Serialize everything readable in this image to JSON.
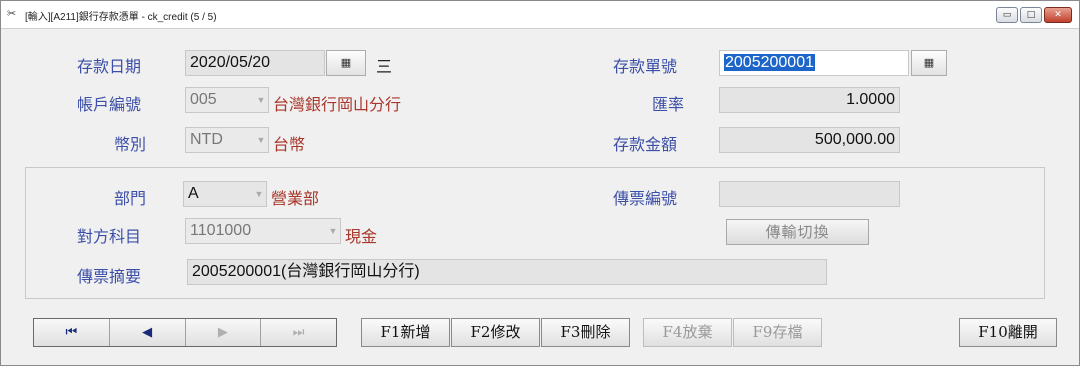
{
  "window": {
    "title": "[輸入][A211]銀行存款憑單 - ck_credit   (5 / 5)",
    "controls": [
      "minimize-icon",
      "maximize-icon",
      "close-icon"
    ]
  },
  "form": {
    "deposit_date": {
      "label": "存款日期",
      "value": "2020/05/20",
      "weekday": "三"
    },
    "account_no": {
      "label": "帳戶編號",
      "value": "005",
      "desc": "台灣銀行岡山分行"
    },
    "currency": {
      "label": "幣別",
      "value": "NTD",
      "desc": "台幣"
    },
    "deposit_no": {
      "label": "存款單號",
      "value": "2005200001"
    },
    "exchange_rate": {
      "label": "匯率",
      "value": "1.0000"
    },
    "deposit_amount": {
      "label": "存款金額",
      "value": "500,000.00"
    },
    "department": {
      "label": "部門",
      "value": "A",
      "desc": "營業部"
    },
    "voucher_no": {
      "label": "傳票編號",
      "value": ""
    },
    "counter_account": {
      "label": "對方科目",
      "value": "1101000",
      "desc": "現金"
    },
    "voucher_summary": {
      "label": "傳票摘要",
      "value": "2005200001(台灣銀行岡山分行)"
    },
    "transfer_toggle_label": "傳輸切換"
  },
  "navigation": {
    "first": "⏮",
    "prev": "◀",
    "next": "▶",
    "last": "⏭"
  },
  "toolbar": {
    "add": "F1新增",
    "edit": "F2修改",
    "delete": "F3刪除",
    "discard": "F4放棄",
    "save": "F9存檔",
    "exit": "F10離開"
  }
}
